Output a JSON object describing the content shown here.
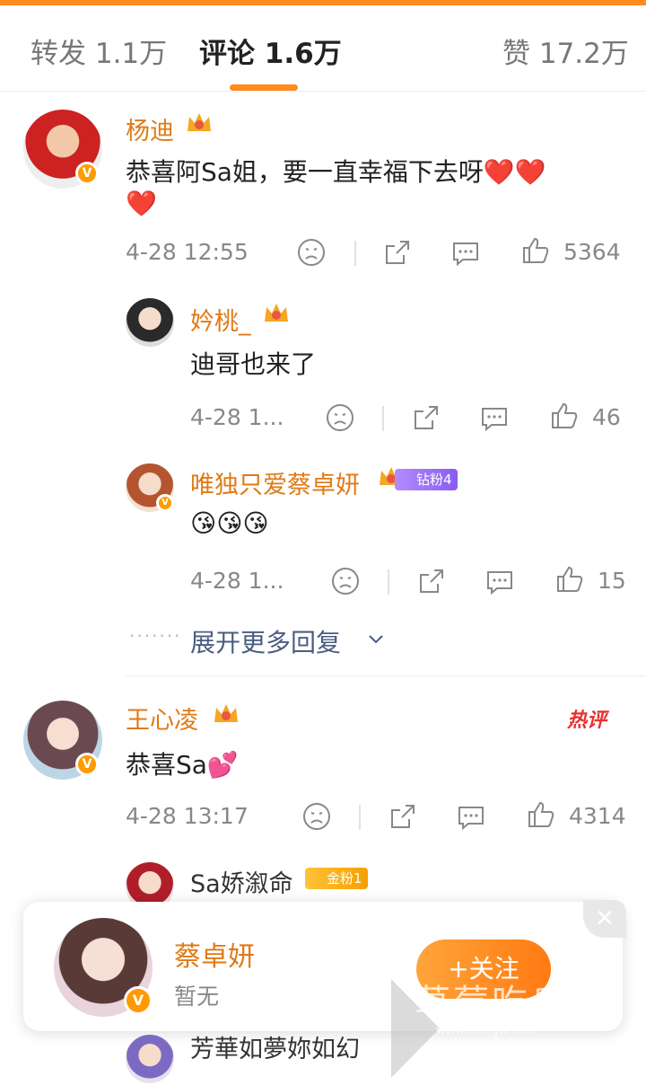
{
  "tabs": {
    "repost": "转发 1.1万",
    "comments": "评论 1.6万",
    "likes": "赞 17.2万"
  },
  "comments": [
    {
      "name": "杨迪",
      "text": "恭喜阿Sa姐，要一直幸福下去呀❤️❤️",
      "text2": "❤️",
      "time": "4-28 12:55",
      "likes": "5364",
      "replies": [
        {
          "name": "妗桃_",
          "text": "迪哥也来了",
          "time": "4-28 1...",
          "likes": "46"
        },
        {
          "name": "唯独只爱蔡卓妍",
          "badge": "钻粉4",
          "text": "😘😘😘",
          "time": "4-28 1...",
          "likes": "15"
        }
      ],
      "more_replies": "展开更多回复"
    },
    {
      "name": "王心凌",
      "hot_label": "热评",
      "text": "恭喜Sa💕",
      "time": "4-28 13:17",
      "likes": "4314",
      "replies": [
        {
          "name": "Sa娇溆命",
          "badge": "金粉1"
        },
        {
          "name": "芳華如夢妳如幻"
        }
      ]
    }
  ],
  "follow_card": {
    "name": "蔡卓妍",
    "subtitle": "暂无",
    "follow_button": "+关注"
  },
  "watermark": {
    "text": "草莓吃瓜网",
    "url": "www.cmcgw.com"
  },
  "colors": {
    "accent": "#ff8a1e",
    "username": "#e07a16",
    "link": "#4a5d80",
    "hot": "#e8312f"
  }
}
